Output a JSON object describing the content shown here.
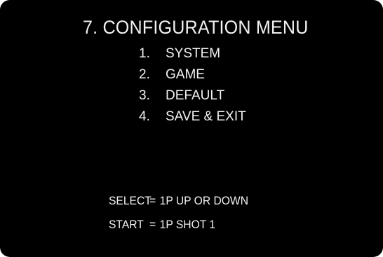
{
  "screen": {
    "title": "7. CONFIGURATION MENU",
    "menu_items": [
      {
        "number": "1.",
        "label": "SYSTEM"
      },
      {
        "number": "2.",
        "label": "GAME"
      },
      {
        "number": "3.",
        "label": "DEFAULT"
      },
      {
        "number": "4.",
        "label": "SAVE & EXIT"
      }
    ],
    "controls": [
      {
        "key": "SELECT",
        "sep": "=",
        "action": "1P UP OR DOWN"
      },
      {
        "key": "START",
        "sep": "=",
        "action": "1P SHOT 1"
      }
    ]
  },
  "colors": {
    "background": "#000000",
    "text": "#f2f2f2",
    "border": "#ffffff"
  }
}
